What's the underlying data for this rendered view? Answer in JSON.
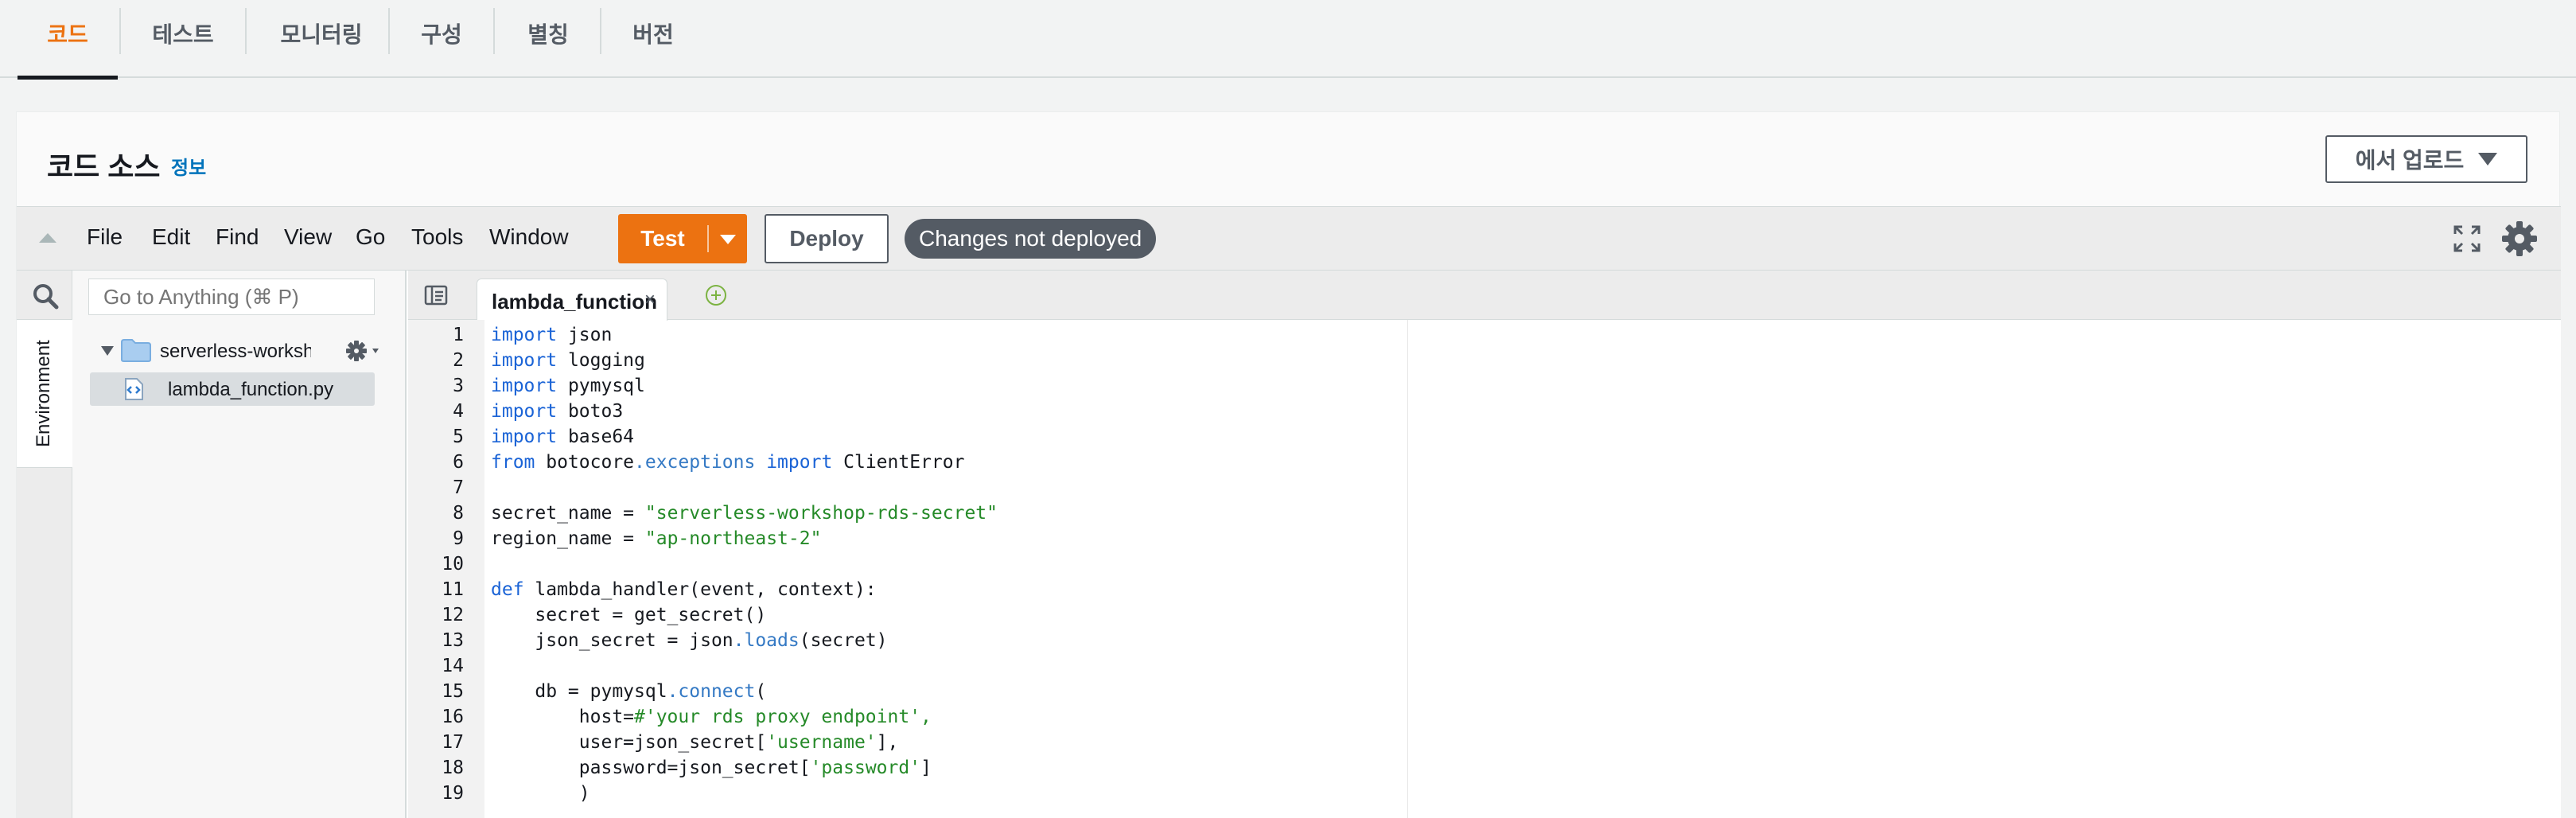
{
  "tabs": [
    {
      "label": "코드",
      "active": true
    },
    {
      "label": "테스트",
      "active": false
    },
    {
      "label": "모니터링",
      "active": false
    },
    {
      "label": "구성",
      "active": false
    },
    {
      "label": "별칭",
      "active": false
    },
    {
      "label": "버전",
      "active": false
    }
  ],
  "panel": {
    "title": "코드 소스",
    "info_link": "정보",
    "upload_button": "에서 업로드"
  },
  "menubar": {
    "items": [
      "File",
      "Edit",
      "Find",
      "View",
      "Go",
      "Tools",
      "Window"
    ],
    "test_button": "Test",
    "deploy_button": "Deploy",
    "status_badge": "Changes not deployed"
  },
  "sidebar": {
    "environment_tab": "Environment",
    "goto_placeholder": "Go to Anything (⌘ P)",
    "folder": "serverless-workshop",
    "file": "lambda_function.py"
  },
  "editor": {
    "active_tab": "lambda_function",
    "close_glyph": "×",
    "lines": [
      {
        "n": "1",
        "tokens": [
          {
            "t": "import",
            "c": "kw"
          },
          {
            "t": " json",
            "c": ""
          }
        ]
      },
      {
        "n": "2",
        "tokens": [
          {
            "t": "import",
            "c": "kw"
          },
          {
            "t": " logging",
            "c": ""
          }
        ]
      },
      {
        "n": "3",
        "tokens": [
          {
            "t": "import",
            "c": "kw"
          },
          {
            "t": " pymysql",
            "c": ""
          }
        ]
      },
      {
        "n": "4",
        "tokens": [
          {
            "t": "import",
            "c": "kw"
          },
          {
            "t": " boto3",
            "c": ""
          }
        ]
      },
      {
        "n": "5",
        "tokens": [
          {
            "t": "import",
            "c": "kw"
          },
          {
            "t": " base64",
            "c": ""
          }
        ]
      },
      {
        "n": "6",
        "tokens": [
          {
            "t": "from",
            "c": "kw"
          },
          {
            "t": " botocore",
            "c": ""
          },
          {
            "t": ".exceptions",
            "c": "fn"
          },
          {
            "t": " ",
            "c": ""
          },
          {
            "t": "import",
            "c": "kw"
          },
          {
            "t": " ClientError",
            "c": ""
          }
        ]
      },
      {
        "n": "7",
        "tokens": []
      },
      {
        "n": "8",
        "tokens": [
          {
            "t": "secret_name = ",
            "c": ""
          },
          {
            "t": "\"serverless-workshop-rds-secret\"",
            "c": "str"
          }
        ]
      },
      {
        "n": "9",
        "tokens": [
          {
            "t": "region_name = ",
            "c": ""
          },
          {
            "t": "\"ap-northeast-2\"",
            "c": "str"
          }
        ]
      },
      {
        "n": "10",
        "tokens": []
      },
      {
        "n": "11",
        "tokens": [
          {
            "t": "def",
            "c": "kw"
          },
          {
            "t": " lambda_handler(event, context):",
            "c": ""
          }
        ]
      },
      {
        "n": "12",
        "tokens": [
          {
            "t": "    secret = get_secret()",
            "c": ""
          }
        ]
      },
      {
        "n": "13",
        "tokens": [
          {
            "t": "    json_secret = json",
            "c": ""
          },
          {
            "t": ".loads",
            "c": "fn"
          },
          {
            "t": "(secret)",
            "c": ""
          }
        ]
      },
      {
        "n": "14",
        "tokens": []
      },
      {
        "n": "15",
        "tokens": [
          {
            "t": "    db = pymysql",
            "c": ""
          },
          {
            "t": ".connect",
            "c": "fn"
          },
          {
            "t": "(",
            "c": ""
          }
        ]
      },
      {
        "n": "16",
        "tokens": [
          {
            "t": "        host=",
            "c": ""
          },
          {
            "t": "#'your rds proxy endpoint',",
            "c": "str"
          }
        ]
      },
      {
        "n": "17",
        "tokens": [
          {
            "t": "        user=json_secret[",
            "c": ""
          },
          {
            "t": "'username'",
            "c": "str"
          },
          {
            "t": "],",
            "c": ""
          }
        ]
      },
      {
        "n": "18",
        "tokens": [
          {
            "t": "        password=json_secret[",
            "c": ""
          },
          {
            "t": "'password'",
            "c": "str"
          },
          {
            "t": "]",
            "c": ""
          }
        ]
      },
      {
        "n": "19",
        "tokens": [
          {
            "t": "        )",
            "c": ""
          }
        ]
      }
    ]
  },
  "colors": {
    "accent_orange": "#ec7211",
    "link_blue": "#0073bb",
    "keyword_blue": "#1a63d6",
    "string_green": "#258a28"
  }
}
